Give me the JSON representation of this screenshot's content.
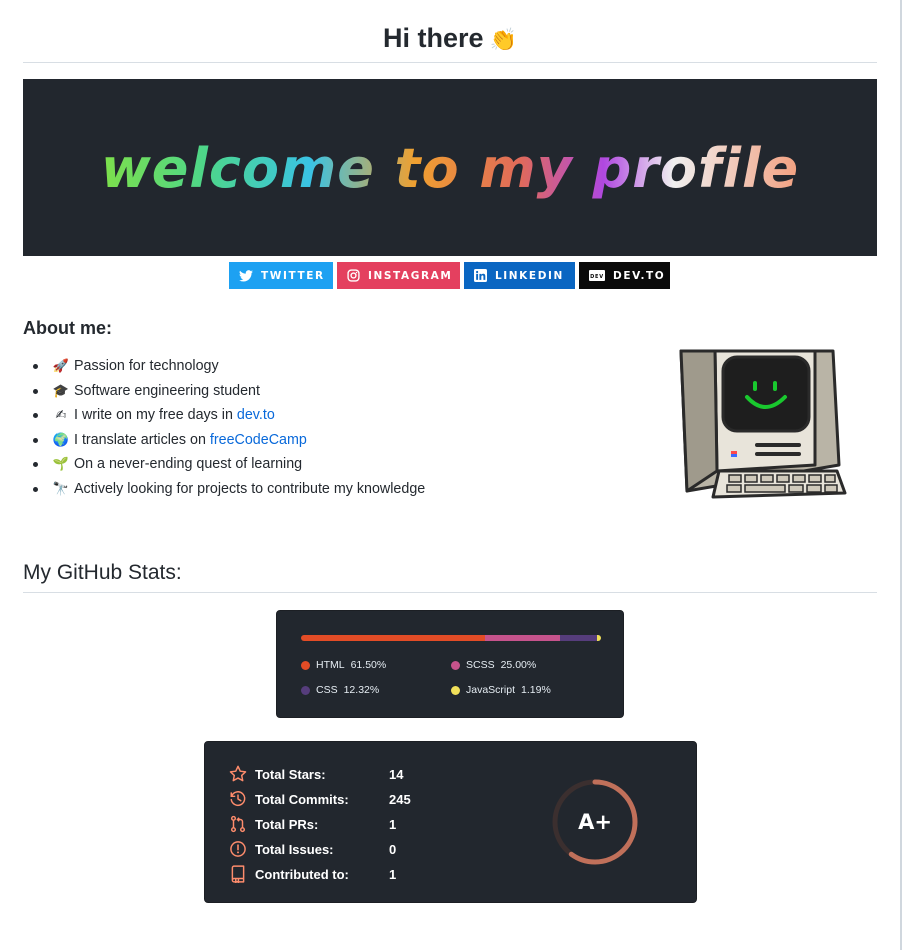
{
  "header": {
    "title": "Hi there",
    "emoji": "👏"
  },
  "banner": {
    "text": "welcome to my profile"
  },
  "badges": [
    {
      "label": "TWITTER",
      "color": "#1da1f2"
    },
    {
      "label": "INSTAGRAM",
      "color": "#e4405f"
    },
    {
      "label": "LINKEDIN",
      "color": "#0a66c2"
    },
    {
      "label": "DEV.TO",
      "color": "#0a0a0a"
    }
  ],
  "about": {
    "heading": "About me:",
    "items": [
      {
        "emoji": "🚀",
        "text": "Passion for technology"
      },
      {
        "emoji": "🎓",
        "text": "Software engineering student"
      },
      {
        "emoji": "✍",
        "text": "I write on my free days in ",
        "link": "dev.to"
      },
      {
        "emoji": "🌍",
        "text": "I translate articles on ",
        "link": "freeCodeCamp"
      },
      {
        "emoji": "🌱",
        "text": "On a never-ending quest of learning"
      },
      {
        "emoji": "🔭",
        "text": "Actively looking for projects to contribute my knowledge"
      }
    ]
  },
  "stats_heading": "My GitHub Stats:",
  "languages": [
    {
      "name": "HTML",
      "pct": "61.50%",
      "value": 61.5,
      "color": "#e34c26"
    },
    {
      "name": "SCSS",
      "pct": "25.00%",
      "value": 25.0,
      "color": "#c6538c"
    },
    {
      "name": "CSS",
      "pct": "12.32%",
      "value": 12.32,
      "color": "#563d7c"
    },
    {
      "name": "JavaScript",
      "pct": "1.19%",
      "value": 1.19,
      "color": "#f1e05a"
    }
  ],
  "stats": [
    {
      "label": "Total Stars:",
      "value": "14",
      "icon": "star-icon"
    },
    {
      "label": "Total Commits:",
      "value": "245",
      "icon": "history-icon"
    },
    {
      "label": "Total PRs:",
      "value": "1",
      "icon": "pull-request-icon"
    },
    {
      "label": "Total Issues:",
      "value": "0",
      "icon": "issue-icon"
    },
    {
      "label": "Contributed to:",
      "value": "1",
      "icon": "repo-icon"
    }
  ],
  "grade": "A+",
  "grade_progress": 0.6,
  "colors": {
    "card_bg": "#22272e",
    "stat_icon": "#fe8c6c",
    "link": "#0969da"
  }
}
